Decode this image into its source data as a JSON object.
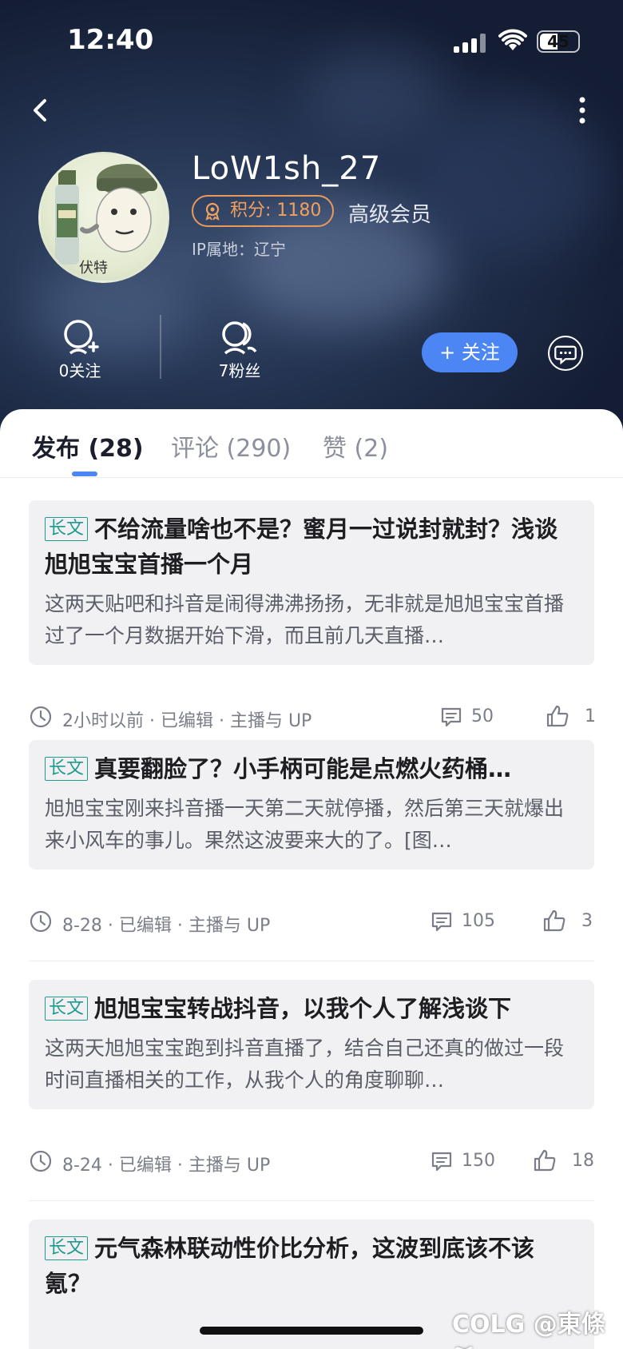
{
  "status_bar": {
    "time": "12:40",
    "battery": "45"
  },
  "profile": {
    "username": "LoW1sh_27",
    "points": "积分: 1180",
    "member_level": "高级会员",
    "ip_location": "IP属地：辽宁",
    "avatar_caption": "伏特"
  },
  "stats": {
    "following": "0关注",
    "followers": "7粉丝"
  },
  "actions": {
    "follow": "+ 关注"
  },
  "tabs": [
    {
      "label": "发布 (28)",
      "active": true
    },
    {
      "label": "评论 (290)",
      "active": false
    },
    {
      "label": "赞 (2)",
      "active": false
    }
  ],
  "posts": [
    {
      "tag": "长文",
      "title": "不给流量啥也不是？蜜月一过说封就封？浅谈旭旭宝宝首播一个月",
      "excerpt": "这两天贴吧和抖音是闹得沸沸扬扬，无非就是旭旭宝宝首播过了一个月数据开始下滑，而且前几天直播…",
      "meta": "2小时以前 · 已编辑 · 主播与 UP",
      "comments": "50",
      "likes": "1"
    },
    {
      "tag": "长文",
      "title": "真要翻脸了？小手柄可能是点燃火药桶…",
      "excerpt": "旭旭宝宝刚来抖音播一天第二天就停播，然后第三天就爆出来小风车的事儿。果然这波要来大的了。[图…",
      "meta": "8-28 · 已编辑 · 主播与 UP",
      "comments": "105",
      "likes": "3"
    },
    {
      "tag": "长文",
      "title": "旭旭宝宝转战抖音，以我个人了解浅谈下",
      "excerpt": "这两天旭旭宝宝跑到抖音直播了，结合自己还真的做过一段时间直播相关的工作，从我个人的角度聊聊…",
      "meta": "8-24 · 已编辑 · 主播与 UP",
      "comments": "150",
      "likes": "18"
    },
    {
      "tag": "长文",
      "title": "元气森林联动性价比分析，这波到底该不该氪？",
      "excerpt": "",
      "meta": "",
      "comments": "",
      "likes": ""
    }
  ],
  "watermark": "COLG @東條希"
}
